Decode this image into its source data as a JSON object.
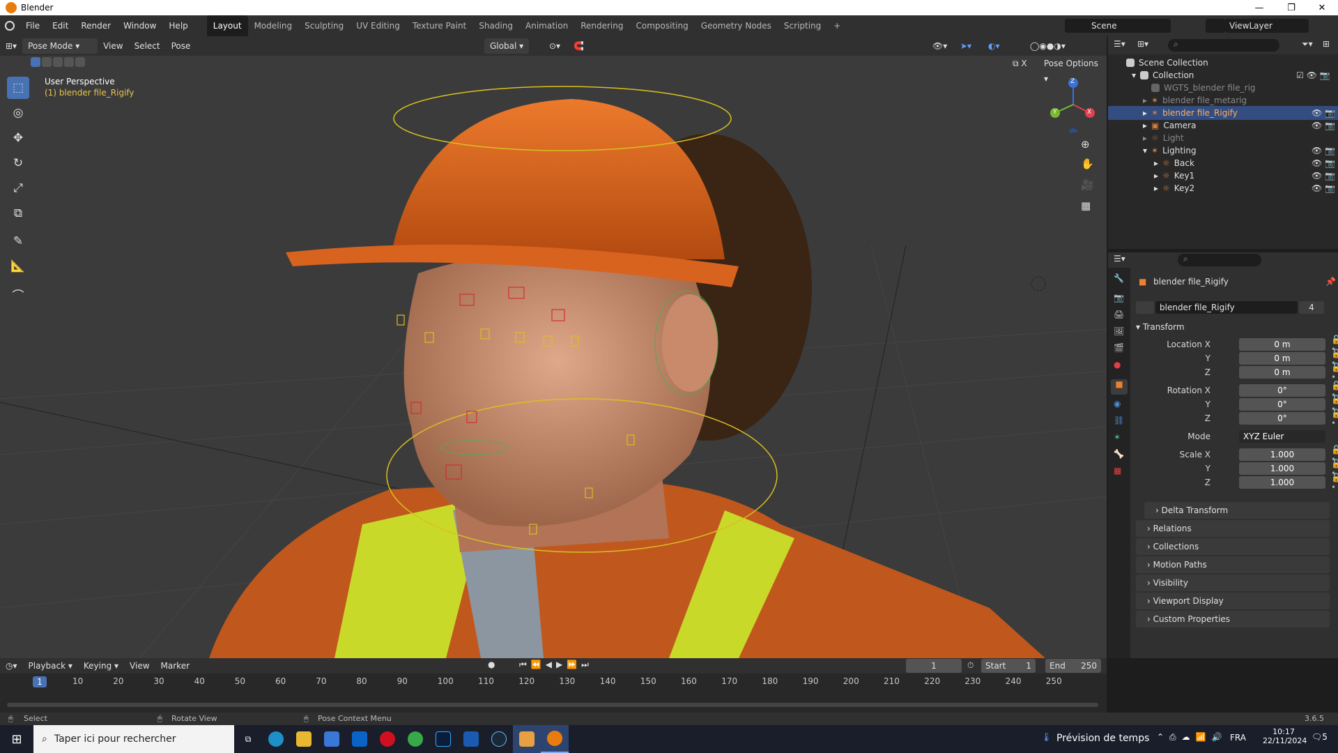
{
  "window": {
    "title": "Blender",
    "controls": [
      "—",
      "❐",
      "✕"
    ]
  },
  "topbar": {
    "menus": [
      "File",
      "Edit",
      "Render",
      "Window",
      "Help"
    ],
    "workspaces": [
      "Layout",
      "Modeling",
      "Sculpting",
      "UV Editing",
      "Texture Paint",
      "Shading",
      "Animation",
      "Rendering",
      "Compositing",
      "Geometry Nodes",
      "Scripting"
    ],
    "add_workspace": "+",
    "scene": "Scene",
    "view_layer": "ViewLayer"
  },
  "viewport": {
    "mode": "Pose Mode",
    "menus": [
      "View",
      "Select",
      "Pose"
    ],
    "orientation": "Global",
    "pose_options": "Pose Options",
    "x_mirror": "X",
    "overlay_title": "User Perspective",
    "overlay_object": "(1) blender file_Rigify",
    "gizmo_axes": {
      "z": "Z",
      "y": "Y",
      "x": "X"
    }
  },
  "outliner": {
    "search_placeholder": "",
    "rows": [
      {
        "label": "Scene Collection"
      },
      {
        "label": "Collection"
      },
      {
        "label": "WGTS_blender file_rig"
      },
      {
        "label": "blender file_metarig"
      },
      {
        "label": "blender file_Rigify"
      },
      {
        "label": "Camera"
      },
      {
        "label": "Light"
      },
      {
        "label": "Lighting"
      },
      {
        "label": "Back"
      },
      {
        "label": "Key1"
      },
      {
        "label": "Key2"
      }
    ]
  },
  "properties": {
    "object_name": "blender file_Rigify",
    "data_name": "blender file_Rigify",
    "users": "4",
    "transform_header": "Transform",
    "location": {
      "label": "Location X",
      "x": "0 m",
      "y": "0 m",
      "z": "0 m"
    },
    "rotation": {
      "label": "Rotation X",
      "x": "0°",
      "y": "0°",
      "z": "0°"
    },
    "axis_y": "Y",
    "axis_z": "Z",
    "mode_label": "Mode",
    "mode_value": "XYZ Euler",
    "scale": {
      "label": "Scale X",
      "x": "1.000",
      "y": "1.000",
      "z": "1.000"
    },
    "panels": [
      "Delta Transform",
      "Relations",
      "Collections",
      "Motion Paths",
      "Visibility",
      "Viewport Display",
      "Custom Properties"
    ]
  },
  "timeline": {
    "menus": [
      "Playback",
      "Keying",
      "View",
      "Marker"
    ],
    "current_frame": "1",
    "start_label": "Start",
    "start": "1",
    "end_label": "End",
    "end": "250",
    "ticks": [
      "10",
      "20",
      "30",
      "40",
      "50",
      "60",
      "70",
      "80",
      "90",
      "100",
      "110",
      "120",
      "130",
      "140",
      "150",
      "160",
      "170",
      "180",
      "190",
      "200",
      "210",
      "220",
      "230",
      "240",
      "250"
    ],
    "playhead": "1"
  },
  "statusbar": {
    "select": "Select",
    "rotate": "Rotate View",
    "context": "Pose Context Menu",
    "version": "3.6.5"
  },
  "taskbar": {
    "search_placeholder": "Taper ici pour rechercher",
    "weather": "Prévision de temps",
    "lang": "FRA",
    "time": "10:17",
    "date": "22/11/2024",
    "notifications": "5"
  }
}
